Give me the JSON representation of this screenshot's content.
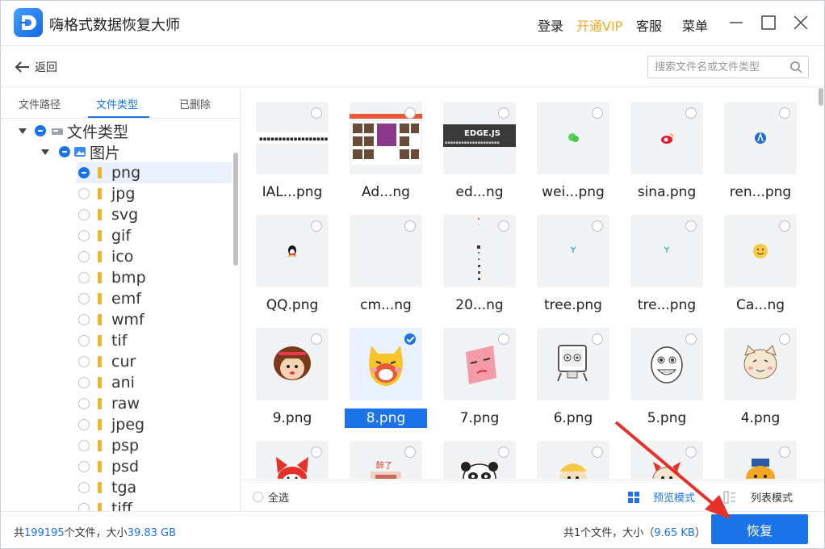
{
  "app": {
    "title": "嗨格式数据恢复大师"
  },
  "header": {
    "login": "登录",
    "vip": "开通VIP",
    "service": "客服",
    "menu": "菜单"
  },
  "toolbar": {
    "back": "返回",
    "search_placeholder": "搜索文件名或文件类型"
  },
  "tabs": [
    "文件路径",
    "文件类型",
    "已删除"
  ],
  "tree": {
    "root": "文件类型",
    "images": "图片",
    "types": [
      "png",
      "jpg",
      "svg",
      "gif",
      "ico",
      "bmp",
      "emf",
      "wmf",
      "tif",
      "cur",
      "ani",
      "raw",
      "jpeg",
      "psp",
      "psd",
      "tga",
      "tiff"
    ]
  },
  "files": [
    {
      "name": "IAL...png"
    },
    {
      "name": "Ad...ng"
    },
    {
      "name": "ed...ng"
    },
    {
      "name": "wei...png"
    },
    {
      "name": "sina.png"
    },
    {
      "name": "ren...png"
    },
    {
      "name": "QQ.png"
    },
    {
      "name": "cm...ng"
    },
    {
      "name": "20...ng"
    },
    {
      "name": "tree.png"
    },
    {
      "name": "tre...png"
    },
    {
      "name": "Ca...ng"
    },
    {
      "name": "9.png"
    },
    {
      "name": "8.png",
      "selected": true
    },
    {
      "name": "7.png"
    },
    {
      "name": "6.png"
    },
    {
      "name": "5.png"
    },
    {
      "name": "4.png"
    },
    {
      "name": ""
    },
    {
      "name": ""
    },
    {
      "name": ""
    },
    {
      "name": ""
    },
    {
      "name": ""
    },
    {
      "name": ""
    }
  ],
  "thumb_text": {
    "edge": "EDGE.JS",
    "ad": "醉了"
  },
  "gridbar": {
    "select_all": "全选",
    "preview_mode": "预览模式",
    "list_mode": "列表模式"
  },
  "status": {
    "total_prefix": "共",
    "total_count": "199195",
    "total_mid": "个文件，大小",
    "total_size": "39.83 GB",
    "sel_prefix": "共1个文件，大小（",
    "sel_size": "9.65 KB",
    "sel_suffix": "）",
    "recover": "恢复"
  },
  "colors": {
    "accent": "#1a73e8",
    "vip": "#f5a623",
    "annotation_arrow": "#e8302a"
  }
}
